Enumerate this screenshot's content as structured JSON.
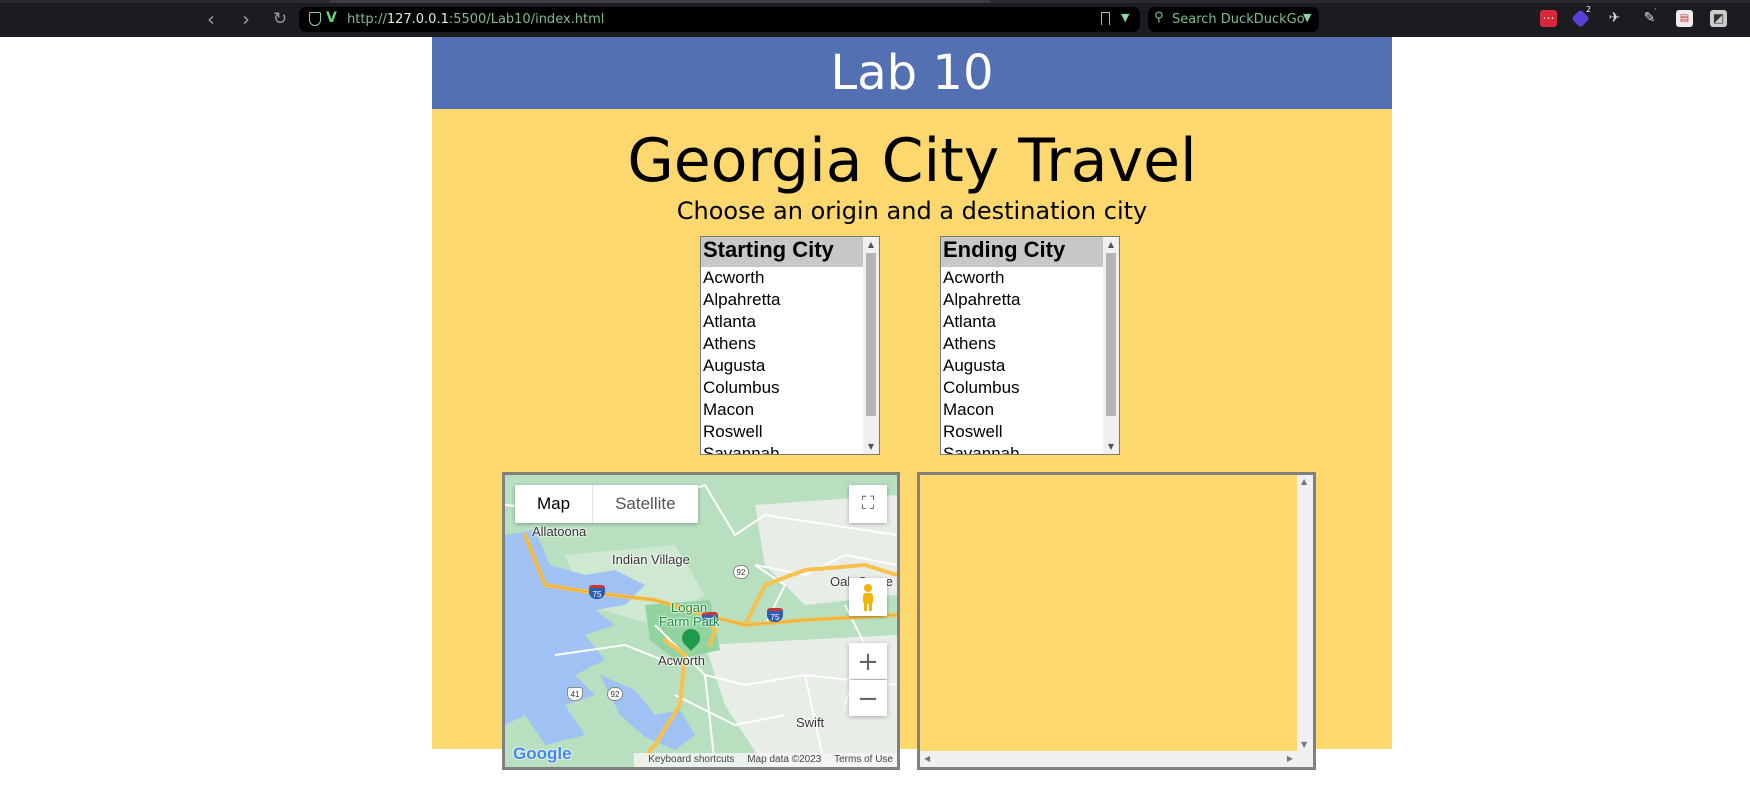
{
  "browser": {
    "url_prefix": "http://",
    "url_host": "127.0.0.1",
    "url_rest": ":5500/Lab10/index.html",
    "search_placeholder": "Search DuckDuckGo",
    "extension_badges": [
      "2",
      "·"
    ]
  },
  "header": {
    "title": "Lab 10"
  },
  "main": {
    "title": "Georgia City Travel",
    "subtitle": "Choose an origin and a destination city"
  },
  "start_list": {
    "group_label": "Starting City",
    "options": [
      "Acworth",
      "Alpahretta",
      "Atlanta",
      "Athens",
      "Augusta",
      "Columbus",
      "Macon",
      "Roswell",
      "Savannah"
    ]
  },
  "end_list": {
    "group_label": "Ending City",
    "options": [
      "Acworth",
      "Alpahretta",
      "Atlanta",
      "Athens",
      "Augusta",
      "Columbus",
      "Macon",
      "Roswell",
      "Savannah"
    ]
  },
  "map": {
    "type_map": "Map",
    "type_satellite": "Satellite",
    "labels": {
      "allatoona": "Allatoona",
      "indian_village": "Indian Village",
      "logan_farm_park": "Logan",
      "logan_farm_park_2": "Farm Park",
      "acworth": "Acworth",
      "oak_grove": "Oak Grove",
      "swift": "Swift"
    },
    "shields": {
      "i75_a": "75",
      "i75_b": "75",
      "i75_c": "75",
      "us41": "41",
      "ga92_a": "92",
      "ga92_b": "92"
    },
    "google_logo": "Google",
    "footer": {
      "shortcuts": "Keyboard shortcuts",
      "map_data": "Map data ©2023",
      "terms": "Terms of Use"
    },
    "colors": {
      "land": "#a8dcb1",
      "water": "#9fc1f4",
      "highway": "#f7c14b",
      "road": "#ffffff"
    }
  },
  "colors": {
    "header_bg": "#5370b3",
    "page_bg": "#fdd86e"
  }
}
